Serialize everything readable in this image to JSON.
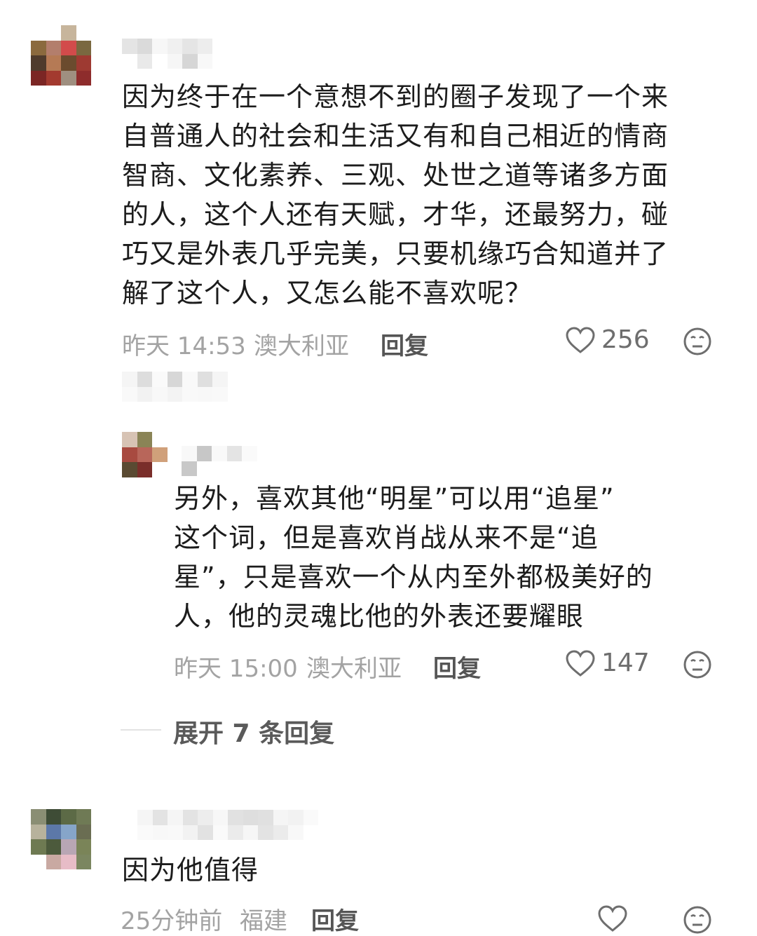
{
  "comments": [
    {
      "text": "因为终于在一个意想不到的圈子发现了一个来\n自普通人的社会和生活又有和自己相近的情商\n智商、文化素养、三观、处世之道等诸多方面\n的人，这个人还有天赋，才华，还最努力，碰\n巧又是外表几乎完美，只要机缘巧合知道并了\n解了这个人，又怎么能不喜欢呢？",
      "time": "昨天 14:53",
      "location": "澳大利亚",
      "reply_label": "回复",
      "likes": "256",
      "avatar_icon": "pixelated-avatar",
      "name_icon": "pixelated-username"
    },
    {
      "text": "另外，喜欢其他“明星”可以用“追星”\n这个词，但是喜欢肖战从来不是“追\n星”，只是喜欢一个从内至外都极美好的\n人，他的灵魂比他的外表还要耀眼",
      "time": "昨天 15:00",
      "location": "澳大利亚",
      "reply_label": "回复",
      "likes": "147",
      "avatar_icon": "pixelated-avatar",
      "name_icon": "pixelated-username"
    },
    {
      "text": "因为他值得",
      "time": "25分钟前",
      "location": "福建",
      "reply_label": "回复",
      "likes": "",
      "avatar_icon": "pixelated-avatar",
      "name_icon": "pixelated-username"
    }
  ],
  "expand_replies": {
    "label": "展开 7 条回复"
  },
  "icons": {
    "like": "heart-icon",
    "dislike": "neutral-face-icon"
  },
  "colors": {
    "text": "#1c1c1c",
    "meta": "#a3a3a3",
    "icon": "#6e6e6e"
  }
}
